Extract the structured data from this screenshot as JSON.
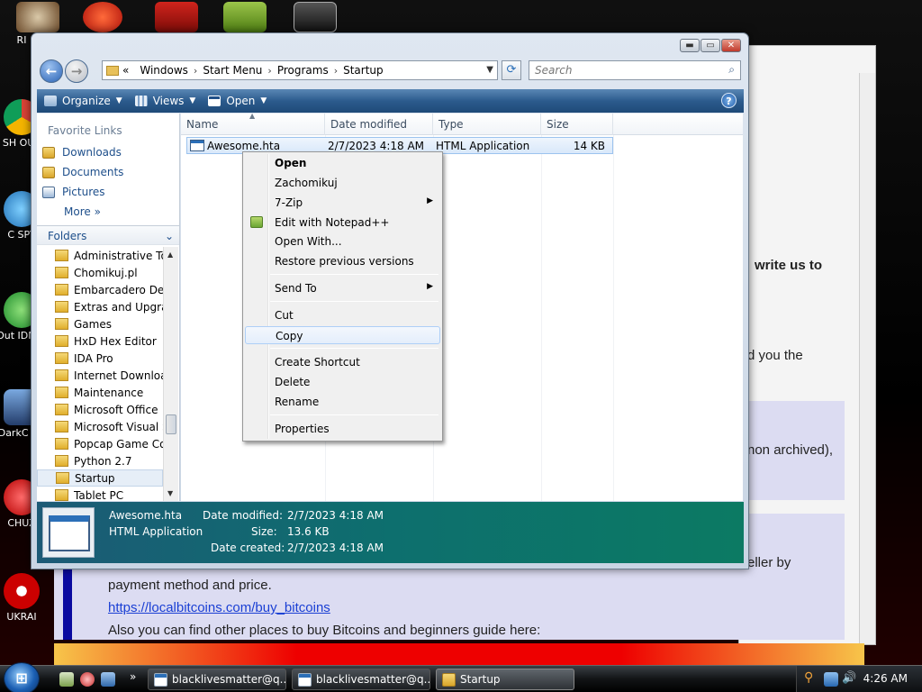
{
  "desktop": {
    "icons": [
      {
        "label": "RI"
      },
      {
        "label": "SH OUT"
      },
      {
        "label": "C SPY"
      },
      {
        "label": "Out IDM C"
      },
      {
        "label": "DarkC Ga"
      },
      {
        "label": "CHUZ"
      },
      {
        "label": "UKRAI"
      }
    ]
  },
  "background_page": {
    "line1": "write us to",
    "line2": "d you the",
    "line3": "non archived),",
    "line4": "eller by",
    "line5": "payment method and price.",
    "link": "https://localbitcoins.com/buy_bitcoins",
    "line6": "Also you can find other places to buy Bitcoins and beginners guide here:"
  },
  "explorer": {
    "address": {
      "overflow": "«",
      "crumbs": [
        "Windows",
        "Start Menu",
        "Programs",
        "Startup"
      ]
    },
    "search_placeholder": "Search",
    "toolbar": {
      "organize": "Organize",
      "views": "Views",
      "open": "Open"
    },
    "nav": {
      "favorite_links_title": "Favorite Links",
      "favorites": [
        "Downloads",
        "Documents",
        "Pictures"
      ],
      "more": "More",
      "folders_title": "Folders",
      "folders": [
        "Administrative Too",
        "Chomikuj.pl",
        "Embarcadero Dev-",
        "Extras and Upgrade",
        "Games",
        "HxD Hex Editor",
        "IDA Pro",
        "Internet Download",
        "Maintenance",
        "Microsoft Office",
        "Microsoft Visual St",
        "Popcap Game Coll",
        "Python 2.7",
        "Startup",
        "Tablet PC"
      ],
      "selected_folder": "Startup"
    },
    "columns": [
      "Name",
      "Date modified",
      "Type",
      "Size"
    ],
    "files": [
      {
        "name": "Awesome.hta",
        "date_modified": "2/7/2023 4:18 AM",
        "type": "HTML Application",
        "size": "14 KB"
      }
    ],
    "details": {
      "name": "Awesome.hta",
      "type": "HTML Application",
      "date_modified_label": "Date modified:",
      "date_modified": "2/7/2023 4:18 AM",
      "size_label": "Size:",
      "size": "13.6 KB",
      "date_created_label": "Date created:",
      "date_created": "2/7/2023 4:18 AM"
    }
  },
  "context_menu": {
    "items": {
      "open": "Open",
      "zachomikuj": "Zachomikuj",
      "zip": "7-Zip",
      "notepad": "Edit with Notepad++",
      "open_with": "Open With...",
      "restore": "Restore previous versions",
      "send_to": "Send To",
      "cut": "Cut",
      "copy": "Copy",
      "create_shortcut": "Create Shortcut",
      "delete": "Delete",
      "rename": "Rename",
      "properties": "Properties"
    },
    "highlighted": "Copy"
  },
  "taskbar": {
    "tasks": [
      "blacklivesmatter@q...",
      "blacklivesmatter@q...",
      "Startup"
    ],
    "clock": "4:26 AM"
  },
  "colors": {
    "toolbar": "#2c5b8d",
    "details_pane": "#0d6f6e",
    "menu_highlight": "#e4eefb"
  }
}
